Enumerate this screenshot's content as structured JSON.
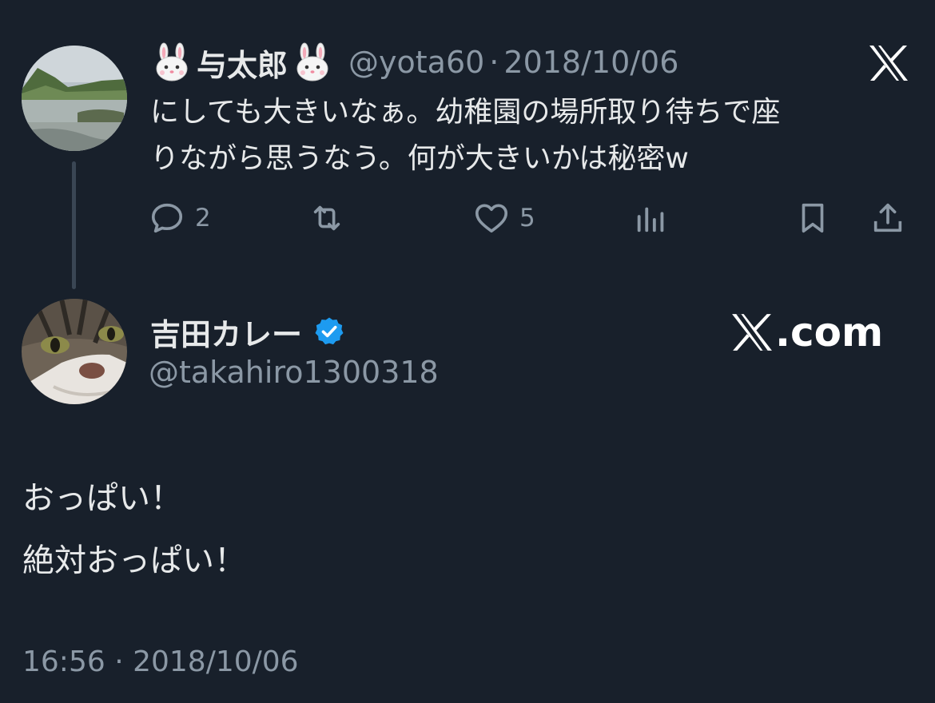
{
  "colors": {
    "background": "#18202b",
    "text_primary": "#e7e9ea",
    "text_secondary": "#8b98a5",
    "verified_badge": "#1d9bf0",
    "thread_line": "#3a4654"
  },
  "parent_tweet": {
    "avatar_icon": "landscape-avatar",
    "name_prefix_icon": "rabbit-emoji",
    "name": "与太郎",
    "name_suffix_icon": "rabbit-emoji",
    "handle": "@yota60",
    "separator": "·",
    "date": "2018/10/06",
    "text_lines": [
      "にしても大きいなぁ。幼稚園の場所取り待ちで座",
      "りながら思うなう。何が大きいかは秘密w"
    ],
    "actions": {
      "reply_count": "2",
      "retweet_count": "",
      "like_count": "5"
    },
    "brand_icon": "x-logo-icon"
  },
  "reply_tweet": {
    "avatar_icon": "cat-avatar",
    "name": "吉田カレー",
    "verified_icon": "verified-badge-icon",
    "handle": "@takahiro1300318",
    "watermark": ".com",
    "text_lines": [
      "おっぱい！",
      "絶対おっぱい！"
    ],
    "timestamp": "16:56 · 2018/10/06"
  }
}
